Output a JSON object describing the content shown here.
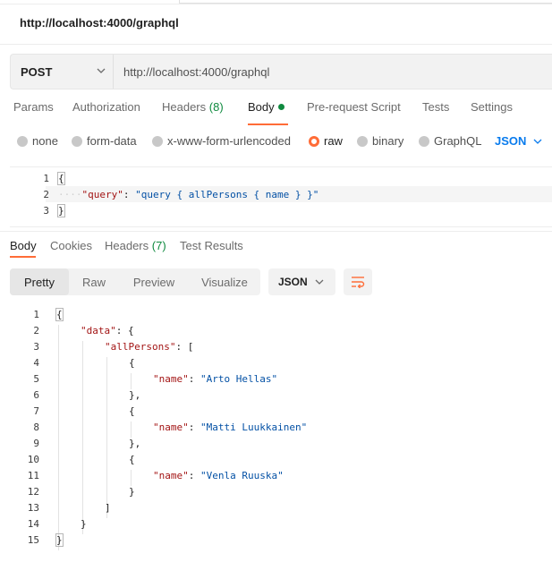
{
  "request": {
    "title": "http://localhost:4000/graphql",
    "method": "POST",
    "url": "http://localhost:4000/graphql"
  },
  "request_tabs": [
    {
      "label": "Params"
    },
    {
      "label": "Authorization"
    },
    {
      "label": "Headers",
      "count": "(8)"
    },
    {
      "label": "Body",
      "active": true
    },
    {
      "label": "Pre-request Script"
    },
    {
      "label": "Tests"
    },
    {
      "label": "Settings"
    }
  ],
  "body_types": [
    {
      "label": "none"
    },
    {
      "label": "form-data"
    },
    {
      "label": "x-www-form-urlencoded"
    },
    {
      "label": "raw",
      "checked": true
    },
    {
      "label": "binary"
    },
    {
      "label": "GraphQL"
    }
  ],
  "raw_language": "JSON",
  "request_body": {
    "line_numbers": [
      "1",
      "2",
      "3"
    ],
    "open_brace": "{",
    "key": "\"query\"",
    "colon": ": ",
    "value": "\"query { allPersons { name } }\"",
    "close_brace": "}"
  },
  "response_tabs": [
    {
      "label": "Body",
      "active": true
    },
    {
      "label": "Cookies"
    },
    {
      "label": "Headers",
      "count": "(7)"
    },
    {
      "label": "Test Results"
    }
  ],
  "view_modes": [
    "Pretty",
    "Raw",
    "Preview",
    "Visualize"
  ],
  "active_view": "Pretty",
  "response_format": "JSON",
  "response_lines": [
    {
      "n": "1",
      "indent": 0,
      "parts": [
        [
          "p",
          "{"
        ]
      ]
    },
    {
      "n": "2",
      "indent": 1,
      "parts": [
        [
          "k",
          "\"data\""
        ],
        [
          "p",
          ": {"
        ]
      ]
    },
    {
      "n": "3",
      "indent": 2,
      "parts": [
        [
          "k",
          "\"allPersons\""
        ],
        [
          "p",
          ": ["
        ]
      ]
    },
    {
      "n": "4",
      "indent": 3,
      "parts": [
        [
          "p",
          "{"
        ]
      ]
    },
    {
      "n": "5",
      "indent": 4,
      "parts": [
        [
          "k",
          "\"name\""
        ],
        [
          "p",
          ": "
        ],
        [
          "s",
          "\"Arto Hellas\""
        ]
      ]
    },
    {
      "n": "6",
      "indent": 3,
      "parts": [
        [
          "p",
          "},"
        ]
      ]
    },
    {
      "n": "7",
      "indent": 3,
      "parts": [
        [
          "p",
          "{"
        ]
      ]
    },
    {
      "n": "8",
      "indent": 4,
      "parts": [
        [
          "k",
          "\"name\""
        ],
        [
          "p",
          ": "
        ],
        [
          "s",
          "\"Matti Luukkainen\""
        ]
      ]
    },
    {
      "n": "9",
      "indent": 3,
      "parts": [
        [
          "p",
          "},"
        ]
      ]
    },
    {
      "n": "10",
      "indent": 3,
      "parts": [
        [
          "p",
          "{"
        ]
      ]
    },
    {
      "n": "11",
      "indent": 4,
      "parts": [
        [
          "k",
          "\"name\""
        ],
        [
          "p",
          ": "
        ],
        [
          "s",
          "\"Venla Ruuska\""
        ]
      ]
    },
    {
      "n": "12",
      "indent": 3,
      "parts": [
        [
          "p",
          "}"
        ]
      ]
    },
    {
      "n": "13",
      "indent": 2,
      "parts": [
        [
          "p",
          "]"
        ]
      ]
    },
    {
      "n": "14",
      "indent": 1,
      "parts": [
        [
          "p",
          "}"
        ]
      ]
    },
    {
      "n": "15",
      "indent": 0,
      "parts": [
        [
          "p",
          "}"
        ]
      ]
    }
  ],
  "colors": {
    "accent": "#ff6c37",
    "success": "#0f8a3f",
    "link": "#097bed",
    "json_key": "#a31515",
    "json_string": "#0451a5"
  }
}
